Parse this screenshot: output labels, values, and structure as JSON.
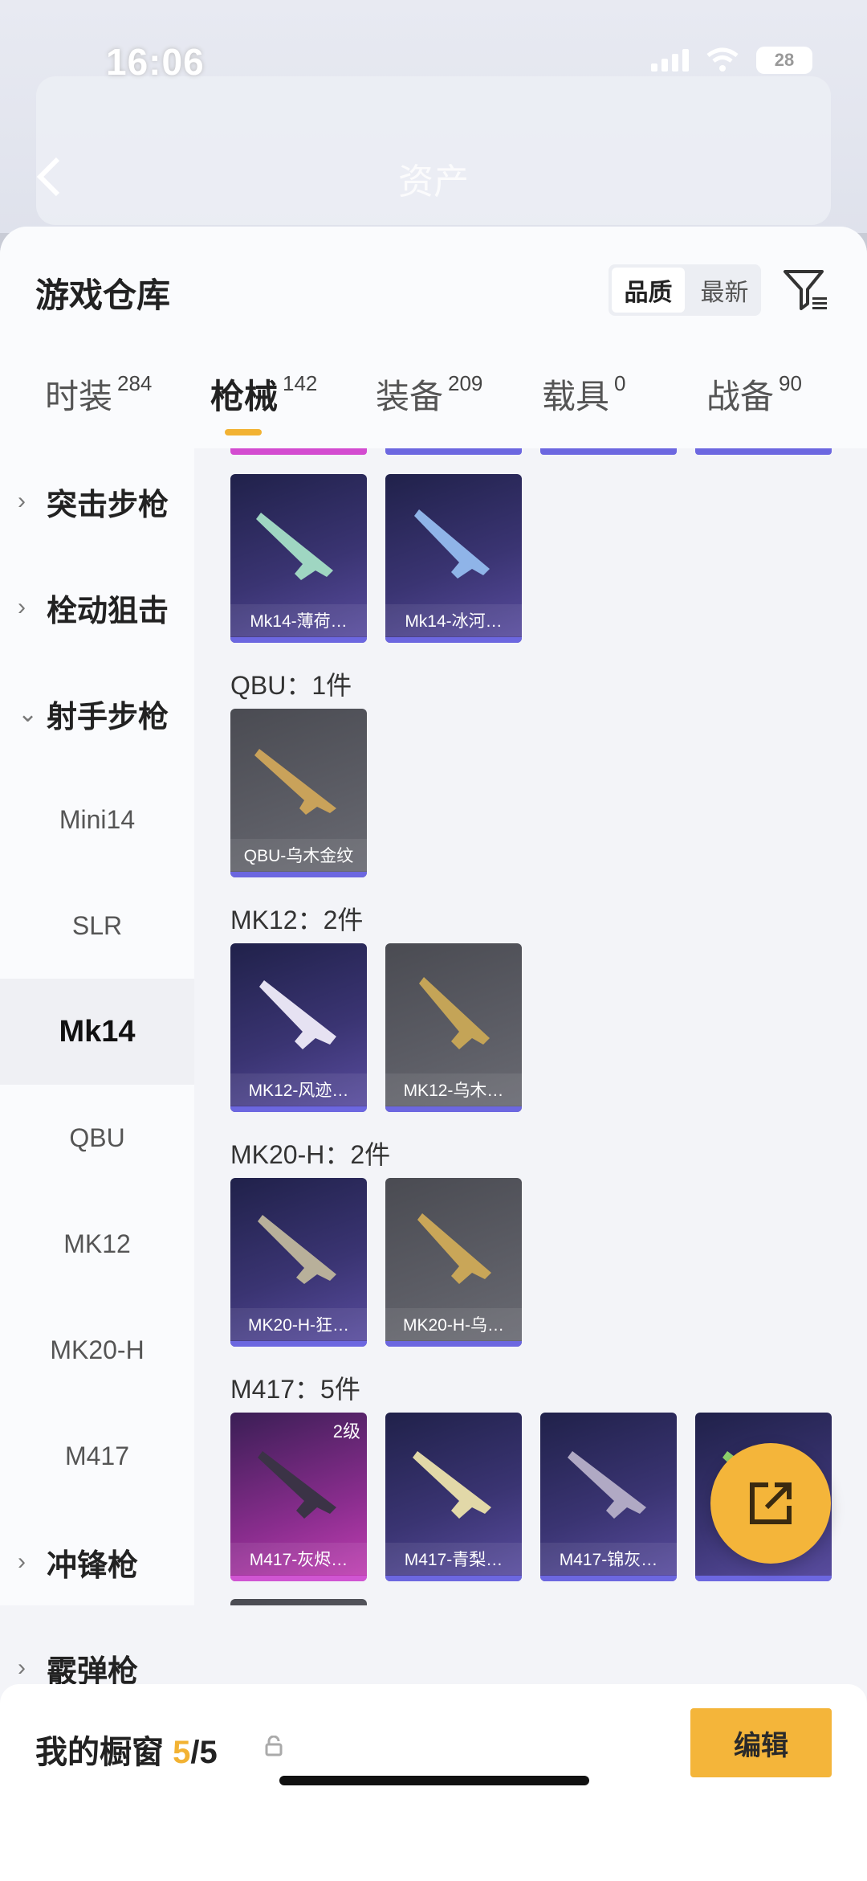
{
  "status": {
    "time": "16:06",
    "battery": "28"
  },
  "header": {
    "title": "资产"
  },
  "sheet": {
    "title": "游戏仓库"
  },
  "sort": {
    "quality": "品质",
    "latest": "最新"
  },
  "tabs": [
    {
      "label": "时装",
      "count": "284"
    },
    {
      "label": "枪械",
      "count": "142"
    },
    {
      "label": "装备",
      "count": "209"
    },
    {
      "label": "载具",
      "count": "0"
    },
    {
      "label": "战备",
      "count": "90"
    }
  ],
  "sidebar": {
    "assault": "突击步枪",
    "bolt": "栓动狙击",
    "marksman": "射手步枪",
    "sub": [
      "Mini14",
      "SLR",
      "Mk14",
      "QBU",
      "MK12",
      "MK20-H",
      "M417"
    ],
    "smg": "冲锋枪",
    "shotgun": "霰弹枪"
  },
  "sections": {
    "qbu": "QBU：1件",
    "mk12": "MK12：2件",
    "mk20": "MK20-H：2件",
    "m417": "M417：5件"
  },
  "items": {
    "mk14": [
      "Mk14-薄荷…",
      "Mk14-冰河…"
    ],
    "qbu": [
      "QBU-乌木金纹"
    ],
    "mk12": [
      "MK12-风迹…",
      "MK12-乌木…"
    ],
    "mk20": [
      "MK20-H-狂…",
      "MK20-H-乌…"
    ],
    "m417": [
      "M417-灰烬…",
      "M417-青梨…",
      "M417-锦灰…"
    ],
    "m417_level": "2级"
  },
  "showcase": {
    "label": "我的橱窗",
    "used": "5",
    "total": "/5"
  },
  "edit_label": "编辑",
  "colors": {
    "accent": "#F4B53A",
    "purple_bar": "#6C67E0"
  }
}
